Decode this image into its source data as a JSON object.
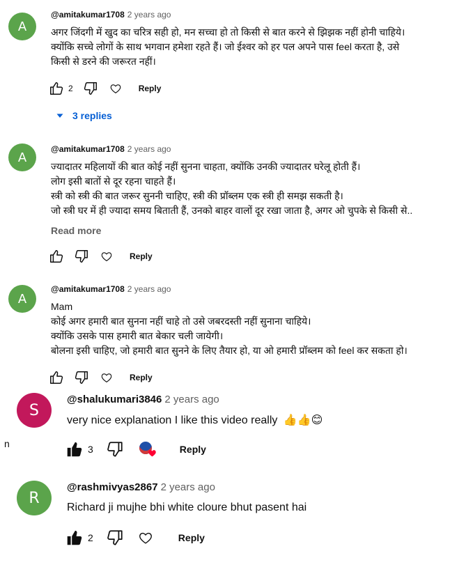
{
  "comments": [
    {
      "avatar_letter": "A",
      "avatar_color": "#5ba44b",
      "author": "@amitakumar1708",
      "time": "2 years ago",
      "lines": [
        "अगर जिंदगी में खुद का चरित्र सही हो, मन सच्चा हो तो किसी से बात करने से झिझक नहीं होनी चाहिये।",
        "क्योंकि सच्चे लोगों के साथ भगवान हमेशा रहते हैं। जो ईश्वर को हर पल अपने पास feel करता  है, उसे",
        "किसी से डरने की जरूरत नहीं।"
      ],
      "like_count": "2",
      "reply_label": "Reply",
      "replies_label": "3 replies"
    },
    {
      "avatar_letter": "A",
      "avatar_color": "#5ba44b",
      "author": "@amitakumar1708",
      "time": "2 years ago",
      "lines": [
        "ज्यादातर महिलायों की बात कोई नहीं सुनना चाहता, क्योंकि उनकी ज्यादातर घरेलू होती हैं।",
        "लोग इसी बातों से दूर रहना चाहते हैं।",
        "स्त्री को स्त्री की बात जरूर सुननी चाहिए,  स्त्री की प्रॉब्लम एक स्त्री ही समझ सकती है।",
        "जो स्त्री घर में ही ज्यादा समय बिताती हैं, उनको बाहर वालों दूर रखा जाता है, अगर ओ चुपके से किसी से.."
      ],
      "read_more": "Read more",
      "like_count": "",
      "reply_label": "Reply"
    },
    {
      "avatar_letter": "A",
      "avatar_color": "#5ba44b",
      "author": "@amitakumar1708",
      "time": "2 years ago",
      "lines": [
        "Mam",
        "कोई अगर हमारी बात सुनना नहीं चाहे तो उसे जबरदस्ती नहीं सुनाना चाहिये।",
        "क्योंकि उसके पास हमारी बात बेकार चली जायेगी।",
        "बोलना इसी चाहिए, जो हमारी बात सुनने के लिए तैयार हो, या ओ हमारी प्रॉब्लम को feel कर सकता हो।"
      ],
      "like_count": "",
      "reply_label": "Reply"
    },
    {
      "avatar_letter": "S",
      "avatar_color": "#c2185b",
      "author": "@shalukumari3846",
      "time": "2 years ago",
      "text": "very nice explanation I like this video really",
      "emojis": "👍👍😊",
      "like_count": "3",
      "reply_label": "Reply"
    },
    {
      "avatar_letter": "R",
      "avatar_color": "#5ba44b",
      "author": "@rashmivyas2867",
      "time": "2 years ago",
      "text": "Richard ji mujhe bhi white cloure bhut pasent hai",
      "like_count": "2",
      "reply_label": "Reply"
    }
  ],
  "edge_char": "n",
  "icons": {
    "like": "thumb-up-outline-icon",
    "like_filled": "thumb-up-filled-icon",
    "dislike": "thumb-down-outline-icon",
    "heart": "heart-outline-icon",
    "creator_heart": "creator-heart-icon",
    "expand": "caret-down-icon"
  },
  "colors": {
    "link_blue": "#065fd4",
    "muted": "#606060"
  }
}
